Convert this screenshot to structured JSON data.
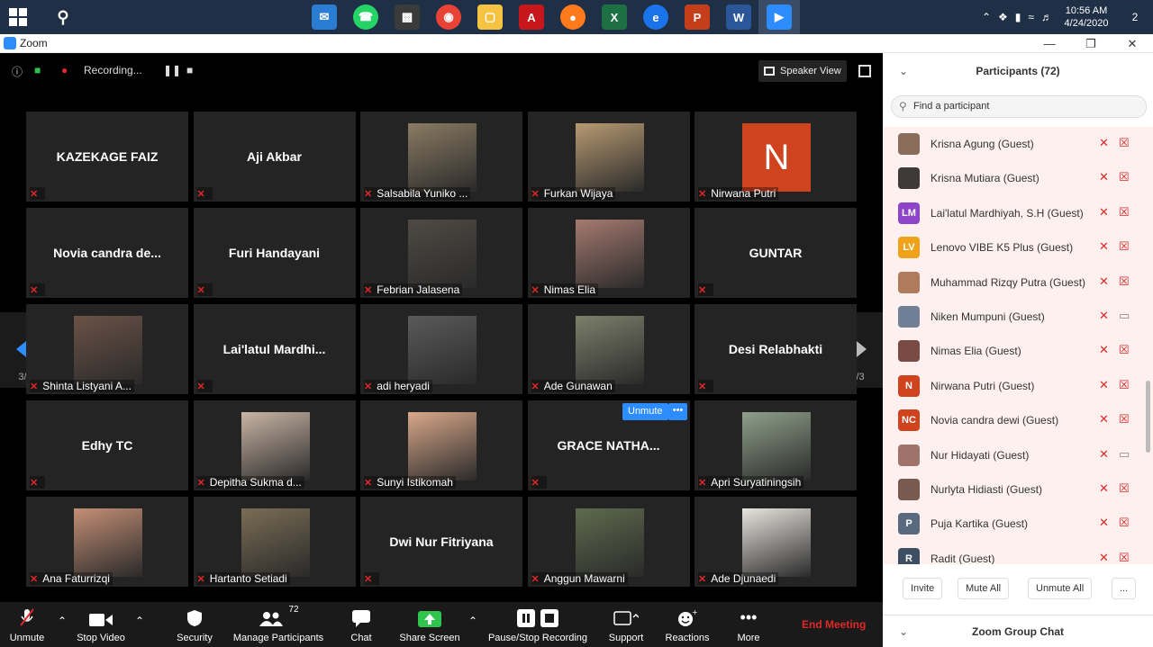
{
  "taskbar": {
    "clock_time": "10:56 AM",
    "clock_date": "4/24/2020",
    "notification_count": "2"
  },
  "window": {
    "title": "Zoom"
  },
  "recording": {
    "label": "Recording..."
  },
  "speaker_view": {
    "label": "Speaker View"
  },
  "pager": {
    "left": "3/3",
    "right": "3/3"
  },
  "tiles": [
    {
      "name": "KAZEKAGE FAIZ",
      "label": "",
      "type": "name"
    },
    {
      "name": "Aji Akbar",
      "label": "",
      "type": "name"
    },
    {
      "name": "",
      "label": "Salsabila Yuniko ...",
      "type": "photo",
      "color": "#8a7b63"
    },
    {
      "name": "",
      "label": "Furkan Wijaya",
      "type": "photo",
      "color": "#b79a72"
    },
    {
      "name": "N",
      "label": "Nirwana Putri",
      "type": "initial",
      "color": "#d0431f"
    },
    {
      "name": "Novia candra de...",
      "label": "",
      "type": "name"
    },
    {
      "name": "Furi Handayani",
      "label": "",
      "type": "name"
    },
    {
      "name": "",
      "label": "Febrian Jalasena",
      "type": "photo",
      "color": "#4f4a44"
    },
    {
      "name": "",
      "label": "Nimas Elia",
      "type": "photo",
      "color": "#a57a70"
    },
    {
      "name": "GUNTAR",
      "label": "",
      "type": "name"
    },
    {
      "name": "",
      "label": "Shinta Listyani A...",
      "type": "photo",
      "color": "#6b5247"
    },
    {
      "name": "Lai'latul Mardhi...",
      "label": "",
      "type": "name"
    },
    {
      "name": "",
      "label": "adi heryadi",
      "type": "photo",
      "color": "#5a5a5a"
    },
    {
      "name": "",
      "label": "Ade Gunawan",
      "type": "photo",
      "color": "#7d7f6b"
    },
    {
      "name": "Desi Relabhakti",
      "label": "",
      "type": "name"
    },
    {
      "name": "Edhy TC",
      "label": "",
      "type": "name"
    },
    {
      "name": "",
      "label": "Depitha Sukma d...",
      "type": "photo",
      "color": "#c9b5a5"
    },
    {
      "name": "",
      "label": "Sunyi Istikomah",
      "type": "photo",
      "color": "#d9a88a"
    },
    {
      "name": "GRACE NATHA...",
      "label": "",
      "type": "name"
    },
    {
      "name": "",
      "label": "Apri Suryatiningsih",
      "type": "photo",
      "color": "#8fa08a"
    },
    {
      "name": "",
      "label": "Ana Faturrizqi",
      "type": "photo",
      "color": "#c48f76"
    },
    {
      "name": "",
      "label": "Hartanto Setiadi",
      "type": "photo",
      "color": "#7a6d55"
    },
    {
      "name": "Dwi Nur Fitriyana",
      "label": "",
      "type": "name"
    },
    {
      "name": "",
      "label": "Anggun Mawarni",
      "type": "photo",
      "color": "#5f6a4d"
    },
    {
      "name": "",
      "label": "Ade Djunaedi",
      "type": "photo",
      "color": "#e8e4df"
    }
  ],
  "tile_hover": {
    "unmute": "Unmute",
    "more": "•••"
  },
  "toolbar": {
    "unmute": "Unmute",
    "stop_video": "Stop Video",
    "security": "Security",
    "manage_participants": "Manage Participants",
    "participants_count": "72",
    "chat": "Chat",
    "share_screen": "Share Screen",
    "pause_recording": "Pause/Stop Recording",
    "support": "Support",
    "reactions": "Reactions",
    "more": "More",
    "end_meeting": "End Meeting"
  },
  "panel": {
    "title": "Participants (72)",
    "search_placeholder": "Find a participant",
    "participants": [
      {
        "name": "Krisna Agung (Guest)",
        "initials": "",
        "color": "#8a6d5a",
        "video_on": false
      },
      {
        "name": "Krisna Mutiara (Guest)",
        "initials": "",
        "color": "#3f3a38",
        "video_on": false
      },
      {
        "name": "Lai'latul Mardhiyah, S.H (Guest)",
        "initials": "LM",
        "color": "#8e44c9",
        "video_on": false
      },
      {
        "name": "Lenovo VIBE K5 Plus (Guest)",
        "initials": "LV",
        "color": "#f0a21a",
        "video_on": false
      },
      {
        "name": "Muhammad Rizqy Putra (Guest)",
        "initials": "",
        "color": "#b07a5c",
        "video_on": false
      },
      {
        "name": "Niken Mumpuni (Guest)",
        "initials": "",
        "color": "#6f7f96",
        "video_on": true
      },
      {
        "name": "Nimas Elia (Guest)",
        "initials": "",
        "color": "#7a4a44",
        "video_on": false
      },
      {
        "name": "Nirwana Putri (Guest)",
        "initials": "N",
        "color": "#d0431f",
        "video_on": false
      },
      {
        "name": "Novia candra dewi (Guest)",
        "initials": "NC",
        "color": "#d0431f",
        "video_on": false
      },
      {
        "name": "Nur Hidayati (Guest)",
        "initials": "",
        "color": "#a0736a",
        "video_on": true
      },
      {
        "name": "Nurlyta Hidiasti (Guest)",
        "initials": "",
        "color": "#7a5a50",
        "video_on": false
      },
      {
        "name": "Puja Kartika (Guest)",
        "initials": "P",
        "color": "#5a6a7e",
        "video_on": false
      },
      {
        "name": "Radit (Guest)",
        "initials": "R",
        "color": "#3e4e62",
        "video_on": false
      }
    ],
    "invite": "Invite",
    "mute_all": "Mute All",
    "unmute_all": "Unmute All",
    "more": "...",
    "chat_title": "Zoom Group Chat"
  }
}
